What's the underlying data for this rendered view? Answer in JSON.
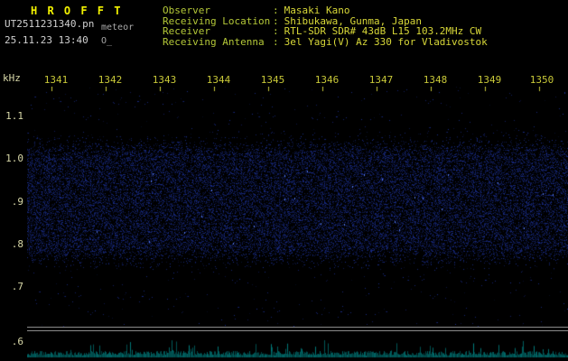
{
  "header": {
    "title": "H R O F F T",
    "filename": "UT2511231340.pn",
    "obs_name": "meteor",
    "datetime": "25.11.23 13:40",
    "status": "O_",
    "colon": ":"
  },
  "info": {
    "rows": [
      {
        "label": "Observer",
        "value": "Masaki Kano"
      },
      {
        "label": "Receiving Location",
        "value": "Shibukawa, Gunma, Japan"
      },
      {
        "label": "Receiver",
        "value": "RTL-SDR SDR# 43dB L15 103.2MHz CW"
      },
      {
        "label": "Receiving Antenna",
        "value": "3el Yagi(V) Az 330 for Vladivostok"
      }
    ]
  },
  "chart_data": {
    "type": "heatmap",
    "title": "HROFFT meteor radio spectrogram 13:40 UT",
    "x_ticks": [
      "1341",
      "1342",
      "1343",
      "1344",
      "1345",
      "1346",
      "1347",
      "1348",
      "1349",
      "1350"
    ],
    "ylabel": "kHz",
    "y_ticks": [
      "1.1",
      "1.0",
      ".9",
      ".8",
      ".7",
      ".6"
    ],
    "ylim": [
      0.6,
      1.17
    ],
    "noise_band_khz": [
      0.8,
      1.0
    ],
    "grid": false,
    "legend": "none",
    "colors": {
      "background": "#000000",
      "title": "#f2f200",
      "tick_text": "#c8c838",
      "axis_text": "#d8d8a8",
      "noise_blue": "#2038a0",
      "signal_strip": "#00a0a0",
      "separator": "#8a8a8a"
    }
  }
}
